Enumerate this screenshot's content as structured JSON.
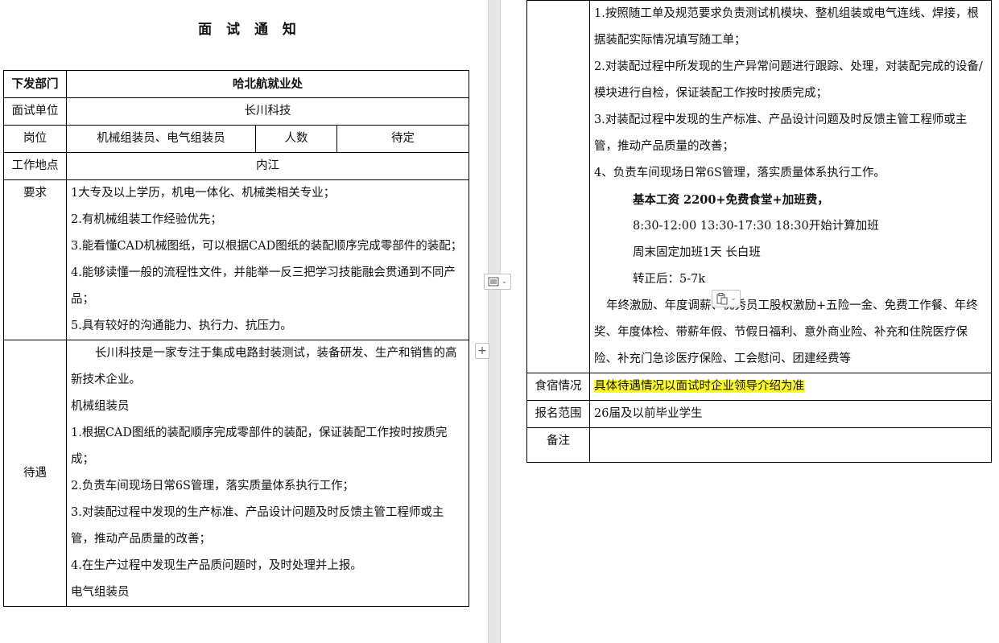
{
  "title": "面 试 通 知",
  "table": {
    "dept_label": "下发部门",
    "dept_value": "哈北航就业处",
    "unit_label": "面试单位",
    "unit_value": "长川科技",
    "position_label": "岗位",
    "position_value": "机械组装员、电气组装员",
    "count_label": "人数",
    "count_value": "待定",
    "location_label": "工作地点",
    "location_value": "内江",
    "req_label": "要求",
    "requirements": [
      "1大专及以上学历，机电一体化、机械类相关专业；",
      "2.有机械组装工作经验优先；",
      "3.能看懂CAD机械图纸，可以根据CAD图纸的装配顺序完成零部件的装配；",
      "4.能够读懂一般的流程性文件，并能举一反三把学习技能融会贯通到不同产品；",
      "5.具有较好的沟通能力、执行力、抗压力。"
    ],
    "treat_label": "待遇",
    "company_intro": "长川科技是一家专注于集成电路封装测试，装备研发、生产和销售的高新技术企业。",
    "mech_title": "机械组装员",
    "mech_duties": [
      "1.根据CAD图纸的装配顺序完成零部件的装配，保证装配工作按时按质完成；",
      "2.负责车间现场日常6S管理，落实质量体系执行工作；",
      "3.对装配过程中发现的生产标准、产品设计问题及时反馈主管工程师或主管，推动产品质量的改善；",
      "4.在生产过程中发现生产品质问题时，及时处理并上报。"
    ],
    "elec_title": "电气组装员",
    "elec_duties": [
      "1.按照随工单及规范要求负责测试机模块、整机组装或电气连线、焊接，根据装配实际情况填写随工单；",
      "2.对装配过程中所发现的生产异常问题进行跟踪、处理，对装配完成的设备/模块进行自检，保证装配工作按时按质完成；",
      "3.对装配过程中发现的生产标准、产品设计问题及时反馈主管工程师或主管，推动产品质量的改善；",
      "4、负责车间现场日常6S管理，落实质量体系执行工作。"
    ],
    "salary_base": "基本工资 2200+免费食堂+加班费，",
    "salary_hours": "8:30-12:00   13:30-17:30   18:30开始计算加班",
    "salary_weekend": "周末固定加班1天 长白班",
    "salary_after": "转正后：5-7k",
    "benefits": "年终激励、年度调薪、优秀员工股权激励+五险一金、免费工作餐、年终奖、年度体检、带薪年假、节假日福利、意外商业险、补充和住院医疗保险、补充门急诊医疗保险、工会慰问、团建经费等",
    "board_label": "食宿情况",
    "board_value": "具体待遇情况以面试时企业领导介绍为准",
    "scope_label": "报名范围",
    "scope_value": "26届及以前毕业学生",
    "remark_label": "备注",
    "remark_value": ""
  },
  "icons": {
    "layout_options": "layout-options-icon",
    "add_row": "plus-icon",
    "paste_options": "paste-icon"
  },
  "colors": {
    "highlight": "#ffff1a"
  }
}
